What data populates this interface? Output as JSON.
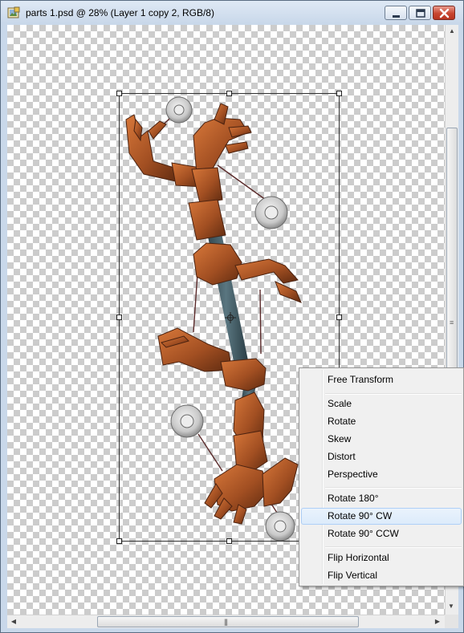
{
  "window": {
    "title": "parts 1.psd @ 28% (Layer 1 copy 2, RGB/8)",
    "controls": [
      "minimize",
      "maximize",
      "close"
    ],
    "close_color": "#c8452f"
  },
  "canvas": {
    "icons": [
      "app-icon",
      "transform-center-icon"
    ]
  },
  "scrollbars": {
    "left_arrow": "◀",
    "right_arrow": "▶",
    "up_arrow": "▲",
    "down_arrow": "▼",
    "grip_h": "|||",
    "grip_v": "≡"
  },
  "context_menu": {
    "items": [
      {
        "label": "Free Transform"
      },
      {
        "label": "Scale"
      },
      {
        "label": "Rotate"
      },
      {
        "label": "Skew"
      },
      {
        "label": "Distort"
      },
      {
        "label": "Perspective"
      },
      {
        "label": "Rotate 180°"
      },
      {
        "label": "Rotate 90° CW",
        "highlighted": true
      },
      {
        "label": "Rotate 90° CCW"
      },
      {
        "label": "Flip Horizontal"
      },
      {
        "label": "Flip Vertical"
      }
    ],
    "highlight_color": "#dcebfb"
  },
  "colors": {
    "artwork_copper": "#b8602e",
    "artwork_shaft": "#3c5660"
  }
}
